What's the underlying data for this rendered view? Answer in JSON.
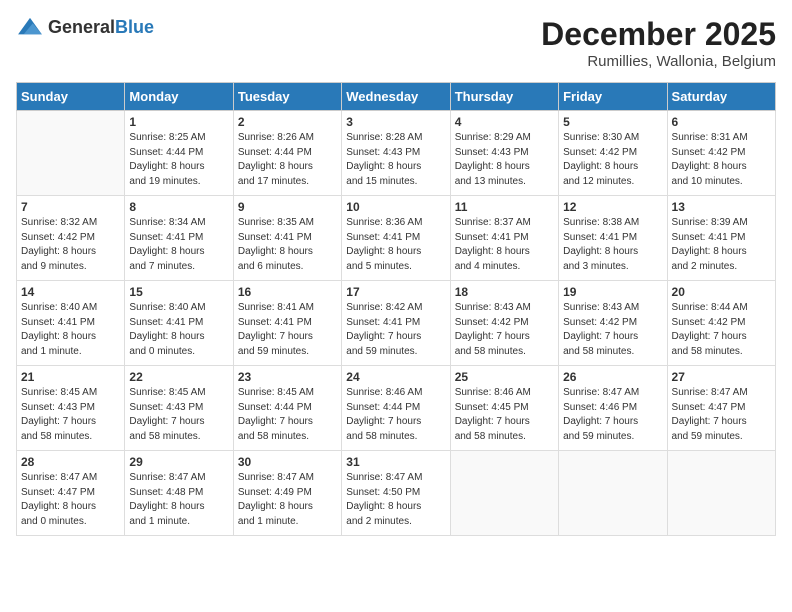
{
  "header": {
    "logo_general": "General",
    "logo_blue": "Blue",
    "month_title": "December 2025",
    "location": "Rumillies, Wallonia, Belgium"
  },
  "weekdays": [
    "Sunday",
    "Monday",
    "Tuesday",
    "Wednesday",
    "Thursday",
    "Friday",
    "Saturday"
  ],
  "weeks": [
    [
      {
        "day": "",
        "info": ""
      },
      {
        "day": "1",
        "info": "Sunrise: 8:25 AM\nSunset: 4:44 PM\nDaylight: 8 hours\nand 19 minutes."
      },
      {
        "day": "2",
        "info": "Sunrise: 8:26 AM\nSunset: 4:44 PM\nDaylight: 8 hours\nand 17 minutes."
      },
      {
        "day": "3",
        "info": "Sunrise: 8:28 AM\nSunset: 4:43 PM\nDaylight: 8 hours\nand 15 minutes."
      },
      {
        "day": "4",
        "info": "Sunrise: 8:29 AM\nSunset: 4:43 PM\nDaylight: 8 hours\nand 13 minutes."
      },
      {
        "day": "5",
        "info": "Sunrise: 8:30 AM\nSunset: 4:42 PM\nDaylight: 8 hours\nand 12 minutes."
      },
      {
        "day": "6",
        "info": "Sunrise: 8:31 AM\nSunset: 4:42 PM\nDaylight: 8 hours\nand 10 minutes."
      }
    ],
    [
      {
        "day": "7",
        "info": "Sunrise: 8:32 AM\nSunset: 4:42 PM\nDaylight: 8 hours\nand 9 minutes."
      },
      {
        "day": "8",
        "info": "Sunrise: 8:34 AM\nSunset: 4:41 PM\nDaylight: 8 hours\nand 7 minutes."
      },
      {
        "day": "9",
        "info": "Sunrise: 8:35 AM\nSunset: 4:41 PM\nDaylight: 8 hours\nand 6 minutes."
      },
      {
        "day": "10",
        "info": "Sunrise: 8:36 AM\nSunset: 4:41 PM\nDaylight: 8 hours\nand 5 minutes."
      },
      {
        "day": "11",
        "info": "Sunrise: 8:37 AM\nSunset: 4:41 PM\nDaylight: 8 hours\nand 4 minutes."
      },
      {
        "day": "12",
        "info": "Sunrise: 8:38 AM\nSunset: 4:41 PM\nDaylight: 8 hours\nand 3 minutes."
      },
      {
        "day": "13",
        "info": "Sunrise: 8:39 AM\nSunset: 4:41 PM\nDaylight: 8 hours\nand 2 minutes."
      }
    ],
    [
      {
        "day": "14",
        "info": "Sunrise: 8:40 AM\nSunset: 4:41 PM\nDaylight: 8 hours\nand 1 minute."
      },
      {
        "day": "15",
        "info": "Sunrise: 8:40 AM\nSunset: 4:41 PM\nDaylight: 8 hours\nand 0 minutes."
      },
      {
        "day": "16",
        "info": "Sunrise: 8:41 AM\nSunset: 4:41 PM\nDaylight: 7 hours\nand 59 minutes."
      },
      {
        "day": "17",
        "info": "Sunrise: 8:42 AM\nSunset: 4:41 PM\nDaylight: 7 hours\nand 59 minutes."
      },
      {
        "day": "18",
        "info": "Sunrise: 8:43 AM\nSunset: 4:42 PM\nDaylight: 7 hours\nand 58 minutes."
      },
      {
        "day": "19",
        "info": "Sunrise: 8:43 AM\nSunset: 4:42 PM\nDaylight: 7 hours\nand 58 minutes."
      },
      {
        "day": "20",
        "info": "Sunrise: 8:44 AM\nSunset: 4:42 PM\nDaylight: 7 hours\nand 58 minutes."
      }
    ],
    [
      {
        "day": "21",
        "info": "Sunrise: 8:45 AM\nSunset: 4:43 PM\nDaylight: 7 hours\nand 58 minutes."
      },
      {
        "day": "22",
        "info": "Sunrise: 8:45 AM\nSunset: 4:43 PM\nDaylight: 7 hours\nand 58 minutes."
      },
      {
        "day": "23",
        "info": "Sunrise: 8:45 AM\nSunset: 4:44 PM\nDaylight: 7 hours\nand 58 minutes."
      },
      {
        "day": "24",
        "info": "Sunrise: 8:46 AM\nSunset: 4:44 PM\nDaylight: 7 hours\nand 58 minutes."
      },
      {
        "day": "25",
        "info": "Sunrise: 8:46 AM\nSunset: 4:45 PM\nDaylight: 7 hours\nand 58 minutes."
      },
      {
        "day": "26",
        "info": "Sunrise: 8:47 AM\nSunset: 4:46 PM\nDaylight: 7 hours\nand 59 minutes."
      },
      {
        "day": "27",
        "info": "Sunrise: 8:47 AM\nSunset: 4:47 PM\nDaylight: 7 hours\nand 59 minutes."
      }
    ],
    [
      {
        "day": "28",
        "info": "Sunrise: 8:47 AM\nSunset: 4:47 PM\nDaylight: 8 hours\nand 0 minutes."
      },
      {
        "day": "29",
        "info": "Sunrise: 8:47 AM\nSunset: 4:48 PM\nDaylight: 8 hours\nand 1 minute."
      },
      {
        "day": "30",
        "info": "Sunrise: 8:47 AM\nSunset: 4:49 PM\nDaylight: 8 hours\nand 1 minute."
      },
      {
        "day": "31",
        "info": "Sunrise: 8:47 AM\nSunset: 4:50 PM\nDaylight: 8 hours\nand 2 minutes."
      },
      {
        "day": "",
        "info": ""
      },
      {
        "day": "",
        "info": ""
      },
      {
        "day": "",
        "info": ""
      }
    ]
  ]
}
